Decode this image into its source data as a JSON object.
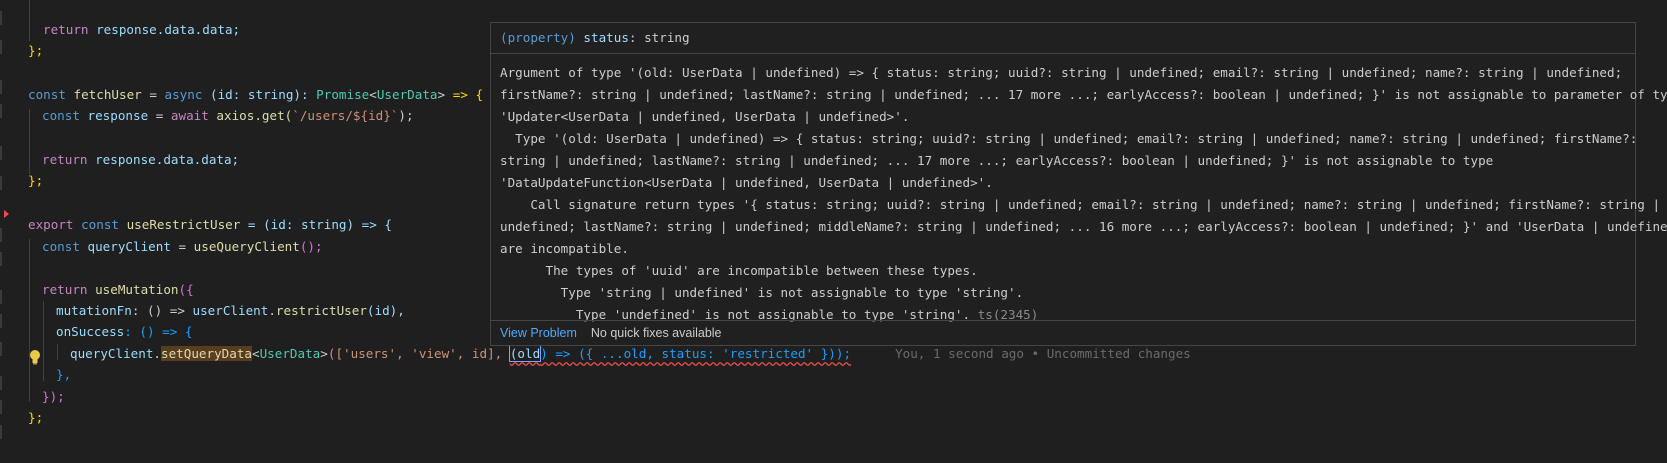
{
  "editor": {
    "blame": "You, 1 second ago • Uncommitted changes",
    "lines": {
      "l1": {
        "kw": "return",
        "rest": " response.data.data;"
      },
      "l2": "};",
      "l4_const": "const",
      "l4_name": "fetchUser",
      "l4_eq": " = ",
      "l4_async": "async",
      "l4_params": " (id: string): ",
      "l4_promise": "Promise",
      "l4_lt": "<",
      "l4_type": "UserData",
      "l4_gt": ">",
      "l4_arrow": " => {",
      "l5_const": "const",
      "l5_var": " response",
      "l5_eq": " = ",
      "l5_await": "await",
      "l5_call": " axios.get(",
      "l5_str": "`/users/${id}`",
      "l5_end": ");",
      "l7_kw": "return",
      "l7_rest": " response.data.data;",
      "l8": "};",
      "l10_export": "export",
      "l10_const": " const",
      "l10_name": " useRestrictUser",
      "l10_rest": " = (id: string) => {",
      "l11_const": "const",
      "l11_var": " queryClient",
      "l11_eq": " = ",
      "l11_call": "useQueryClient",
      "l11_end": "();",
      "l13_kw": "return",
      "l13_call": " useMutation",
      "l13_end": "({",
      "l14_prop": "mutationFn",
      "l14_mid": ": () => ",
      "l14_obj": "userClient",
      "l14_dot": ".",
      "l14_fn": "restrictUser",
      "l14_end": "(id),",
      "l15_prop": "onSuccess",
      "l15_end": ": () => {",
      "l16_obj": "queryClient",
      "l16_dot": ".",
      "l16_fn": "setQueryData",
      "l16_lt": "<",
      "l16_type": "UserData",
      "l16_gt": ">",
      "l16_args": "(['users', 'view', id], ",
      "l16_old": "(old",
      "l16_rest": ") => ({ ...old, status: 'restricted' }));",
      "l17": "},",
      "l18": "});",
      "l19": "};"
    }
  },
  "hover": {
    "header_prefix": "(property) ",
    "header_name": "status",
    "header_type": ": string",
    "diagnostics": [
      "Argument of type '(old: UserData | undefined) => { status: string; uuid?: string | undefined; email?: string | undefined; name?: string | undefined;",
      "firstName?: string | undefined; lastName?: string | undefined; ... 17 more ...; earlyAccess?: boolean | undefined; }' is not assignable to parameter of type",
      "'Updater<UserData | undefined, UserData | undefined>'.",
      "  Type '(old: UserData | undefined) => { status: string; uuid?: string | undefined; email?: string | undefined; name?: string | undefined; firstName?:",
      "string | undefined; lastName?: string | undefined; ... 17 more ...; earlyAccess?: boolean | undefined; }' is not assignable to type",
      "'DataUpdateFunction<UserData | undefined, UserData | undefined>'.",
      "    Call signature return types '{ status: string; uuid?: string | undefined; email?: string | undefined; name?: string | undefined; firstName?: string |",
      "undefined; lastName?: string | undefined; middleName?: string | undefined; ... 16 more ...; earlyAccess?: boolean | undefined; }' and 'UserData | undefined'",
      "are incompatible.",
      "      The types of 'uuid' are incompatible between these types.",
      "        Type 'string | undefined' is not assignable to type 'string'.",
      "          Type 'undefined' is not assignable to type 'string'."
    ],
    "error_code": "ts(2345)",
    "view_problem": "View Problem",
    "no_quick_fixes": "No quick fixes available"
  },
  "colors": {
    "background": "#1f1f1f",
    "keyword": "#569cd6",
    "function": "#dcdcaa",
    "type": "#4ec9b0",
    "string": "#ce9178",
    "link": "#4daafc",
    "error": "#f14c4c"
  },
  "icons": [
    "lightbulb-icon",
    "error-gutter-icon"
  ]
}
